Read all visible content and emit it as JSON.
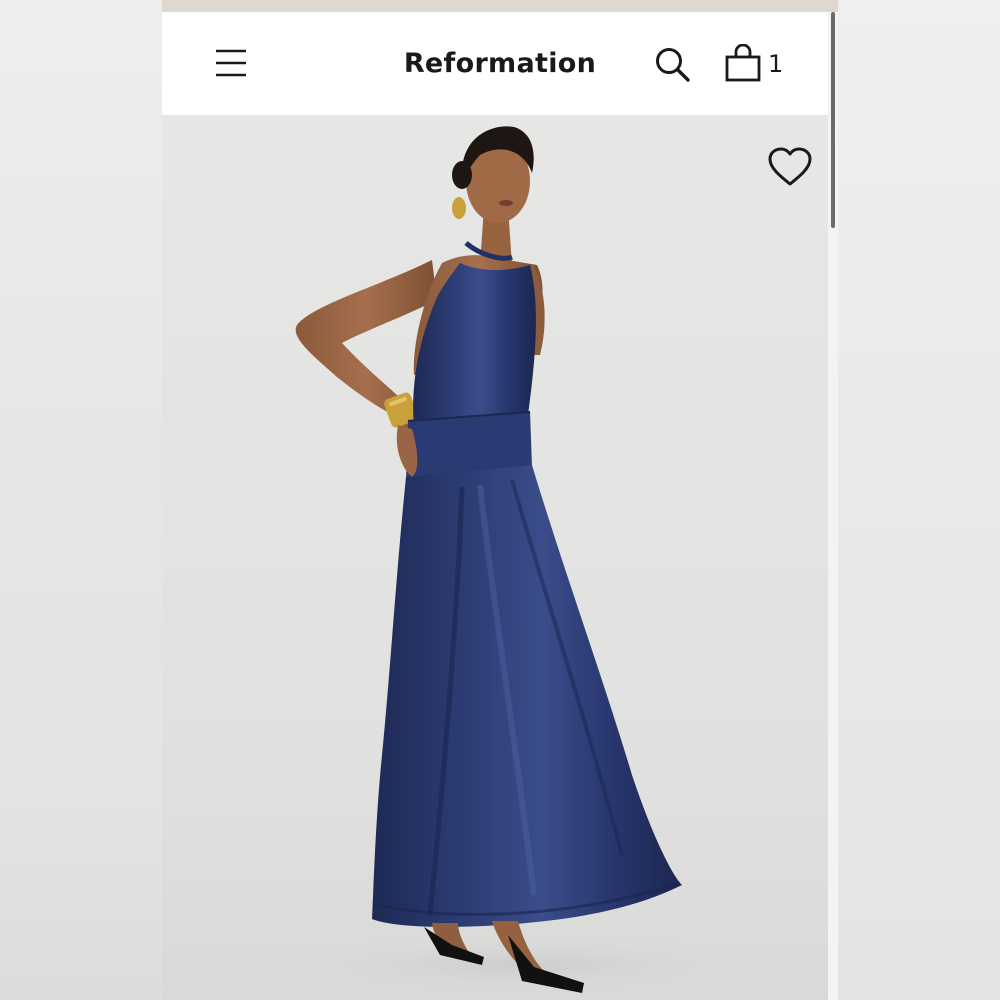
{
  "header": {
    "brand": "Reformation",
    "menu_icon": "hamburger-menu-icon",
    "search_icon": "search-icon",
    "bag_icon": "shopping-bag-icon",
    "bag_count": "1"
  },
  "product": {
    "favorite_icon": "heart-outline-icon",
    "dress_color": "#2b3a6b"
  },
  "colors": {
    "header_bg": "#ffffff",
    "text": "#1a1a1a",
    "photo_bg": "#e4e4e2"
  }
}
